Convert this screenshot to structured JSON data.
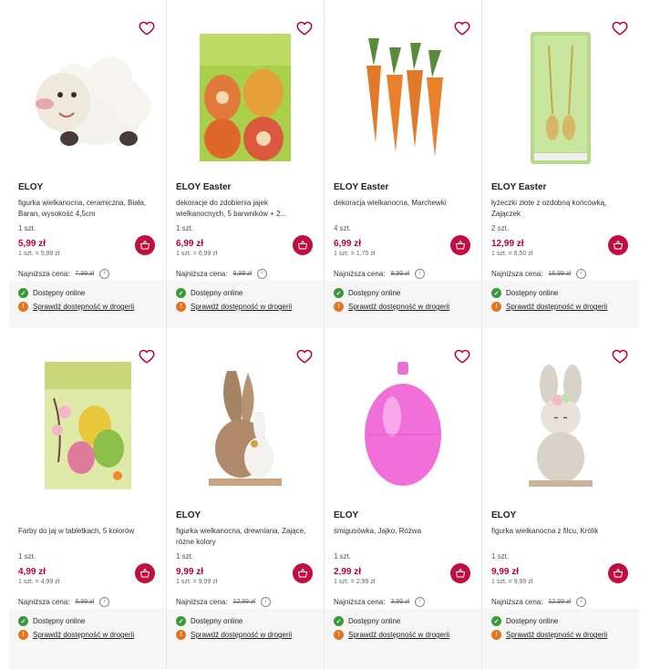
{
  "labels": {
    "lowest": "Najniższa cena:",
    "online": "Dostępny online",
    "check": "Sprawdź dostępność w drogerii"
  },
  "products": [
    {
      "brand": "ELOY",
      "desc": "figurka wielkanocna, ceramiczna, Biała, Baran, wysokość 4,5cm",
      "qty": "1 szt.",
      "price": "5,99 zł",
      "unit": "1 szt. = 5,99 zł",
      "lowest": "7,99 zł",
      "image": "sheep-figurine"
    },
    {
      "brand": "ELOY Easter",
      "desc": "dekoracje do zdobienia jajek wielkanocnych, 5 barwników + 2...",
      "qty": "1 szt.",
      "price": "6,99 zł",
      "unit": "1 szt. = 6,99 zł",
      "lowest": "8,99 zł",
      "image": "egg-decoration-pack"
    },
    {
      "brand": "ELOY Easter",
      "desc": "dekoracja wielkanocna, Marchewki",
      "qty": "4 szt.",
      "price": "6,99 zł",
      "unit": "1 szt. = 1,75 zł",
      "lowest": "8,99 zł",
      "image": "carrots"
    },
    {
      "brand": "ELOY Easter",
      "desc": "łyżeczki złote z ozdobną końcówką, Zajączek",
      "qty": "2 szt.",
      "price": "12,99 zł",
      "unit": "1 szt. = 6,50 zł",
      "lowest": "16,99 zł",
      "image": "spoons-pack"
    },
    {
      "brand": "",
      "desc": "Farby do jaj w tabletkach, 5 kolorów",
      "qty": "1 szt.",
      "price": "4,99 zł",
      "unit": "1 szt. = 4,99 zł",
      "lowest": "6,99 zł",
      "image": "egg-paints"
    },
    {
      "brand": "ELOY",
      "desc": "figurka wielkanocna, drewniana, Zające, różne kolory",
      "qty": "1 szt.",
      "price": "9,99 zł",
      "unit": "1 szt. = 9,99 zł",
      "lowest": "12,99 zł",
      "image": "wooden-bunnies"
    },
    {
      "brand": "ELOY",
      "desc": "śmigusówka, Jajko, Różwa",
      "qty": "1 szt.",
      "price": "2,99 zł",
      "unit": "1 szt. = 2,99 zł",
      "lowest": "3,99 zł",
      "image": "pink-egg"
    },
    {
      "brand": "ELOY",
      "desc": "figurka wielkanocna z filcu, Królik",
      "qty": "1 szt.",
      "price": "9,99 zł",
      "unit": "1 szt. = 9,99 zł",
      "lowest": "12,99 zł",
      "image": "felt-bunny"
    }
  ],
  "colors": {
    "accent": "#c10e3e",
    "price": "#b8003f",
    "available": "#3a9a3a",
    "warning": "#e8731c"
  }
}
